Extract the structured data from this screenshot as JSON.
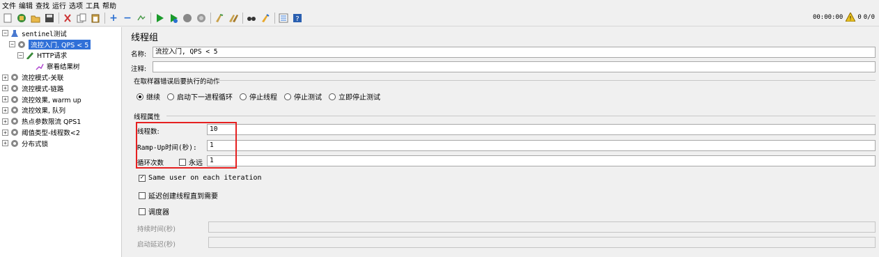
{
  "menu": [
    "文件",
    "编辑",
    "查找",
    "运行",
    "选项",
    "工具",
    "帮助"
  ],
  "toolbar": {
    "icons": [
      "new",
      "templates",
      "open",
      "save",
      "cut",
      "copy",
      "paste",
      "expand",
      "collapse",
      "toggle",
      "start",
      "start-no-pause",
      "stop",
      "shutdown",
      "clear",
      "clear-all",
      "search",
      "reset-search",
      "function-helper",
      "help"
    ],
    "elapsed": "00:00:00",
    "warnings": "0",
    "threads": "0/0"
  },
  "tree": {
    "root": "sentinel测试",
    "items": [
      {
        "label": "流控入门, QPS < 5",
        "selected": true
      },
      {
        "label": "HTTP请求"
      },
      {
        "label": "察看结果树"
      },
      {
        "label": "流控模式-关联"
      },
      {
        "label": "流控模式-链路"
      },
      {
        "label": "流控效果, warm up"
      },
      {
        "label": "流控效果, 队列"
      },
      {
        "label": "热点参数限流 QPS1"
      },
      {
        "label": "阈值类型-线程数<2"
      },
      {
        "label": "分布式锁"
      }
    ]
  },
  "panel": {
    "title": "线程组",
    "name_label": "名称:",
    "name_value": "流控入门, QPS < 5",
    "comment_label": "注释:",
    "comment_value": "",
    "error_section": "在取样器错误后要执行的动作",
    "error_options": [
      {
        "label": "继续",
        "checked": true
      },
      {
        "label": "启动下一进程循环",
        "checked": false
      },
      {
        "label": "停止线程",
        "checked": false
      },
      {
        "label": "停止测试",
        "checked": false
      },
      {
        "label": "立即停止测试",
        "checked": false
      }
    ],
    "thread_section": "线程属性",
    "threads_label": "线程数:",
    "threads_value": "10",
    "rampup_label": "Ramp-Up时间(秒):",
    "rampup_value": "1",
    "loop_label": "循环次数",
    "forever_label": "永远",
    "forever_checked": false,
    "loop_value": "1",
    "same_user_label": "Same user on each iteration",
    "same_user_checked": true,
    "delay_label": "延迟创建线程直到需要",
    "delay_checked": false,
    "scheduler_label": "调度器",
    "scheduler_checked": false,
    "duration_label": "持续时间(秒)",
    "duration_value": "",
    "startup_delay_label": "启动延迟(秒)",
    "startup_delay_value": ""
  },
  "colors": {
    "selection": "#3070d8",
    "highlight_box": "#e62020",
    "background": "#f0f0f0"
  }
}
